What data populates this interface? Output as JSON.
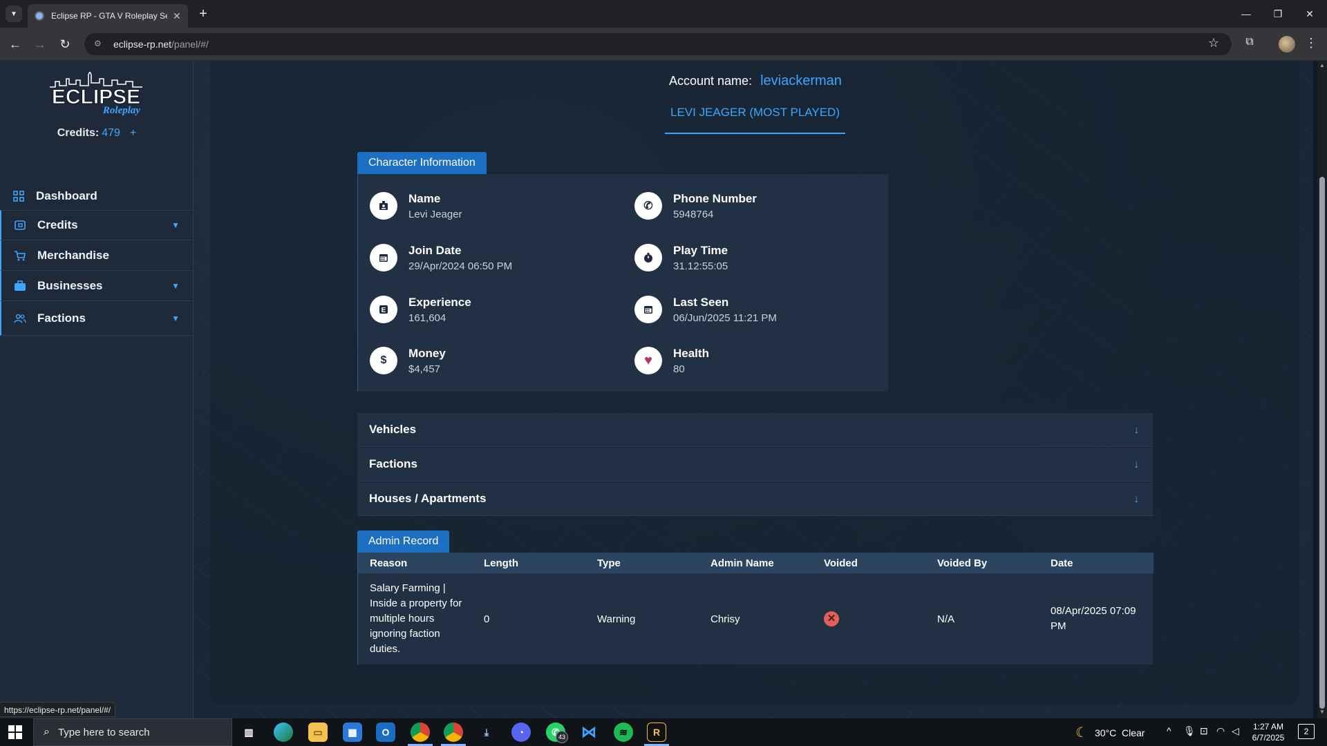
{
  "browser": {
    "tab_title": "Eclipse RP - GTA V Roleplay Server",
    "url_host": "eclipse-rp.net",
    "url_path": "/panel/#/",
    "status_url": "https://eclipse-rp.net/panel/#/"
  },
  "sidebar": {
    "logo_main": "ECLIPSE",
    "logo_sub": "Roleplay",
    "credits_label": "Credits:",
    "credits_value": "479",
    "credits_add": "+",
    "items": [
      {
        "label": "Dashboard",
        "icon": "dashboard-icon",
        "has_chevron": false
      },
      {
        "label": "Credits",
        "icon": "credits-icon",
        "has_chevron": true
      },
      {
        "label": "Merchandise",
        "icon": "cart-icon",
        "has_chevron": false
      },
      {
        "label": "Businesses",
        "icon": "briefcase-icon",
        "has_chevron": true
      },
      {
        "label": "Factions",
        "icon": "people-icon",
        "has_chevron": true
      }
    ]
  },
  "account": {
    "label": "Account name:",
    "name": "leviackerman",
    "character_tab": "LEVI JEAGER (MOST PLAYED)"
  },
  "character_info": {
    "heading": "Character Information",
    "items": [
      {
        "title": "Name",
        "value": "Levi Jeager",
        "icon": "id-badge-icon"
      },
      {
        "title": "Phone Number",
        "value": "5948764",
        "icon": "phone-icon"
      },
      {
        "title": "Join Date",
        "value": "29/Apr/2024 06:50 PM",
        "icon": "calendar-icon"
      },
      {
        "title": "Play Time",
        "value": "31.12:55:05",
        "icon": "stopwatch-icon"
      },
      {
        "title": "Experience",
        "value": "161,604",
        "icon": "experience-icon"
      },
      {
        "title": "Last Seen",
        "value": "06/Jun/2025 11:21 PM",
        "icon": "calendar-icon"
      },
      {
        "title": "Money",
        "value": "$4,457",
        "icon": "dollar-icon"
      },
      {
        "title": "Health",
        "value": "80",
        "icon": "heart-icon"
      }
    ]
  },
  "accordions": [
    "Vehicles",
    "Factions",
    "Houses / Apartments"
  ],
  "admin_record": {
    "heading": "Admin Record",
    "columns": [
      "Reason",
      "Length",
      "Type",
      "Admin Name",
      "Voided",
      "Voided By",
      "Date"
    ],
    "rows": [
      {
        "reason": "Salary Farming | Inside a property for multiple hours ignoring faction duties.",
        "length": "0",
        "type": "Warning",
        "admin_name": "Chrisy",
        "voided": "x-circle-icon",
        "voided_by": "N/A",
        "date": "08/Apr/2025 07:09 PM"
      }
    ]
  },
  "taskbar": {
    "search_placeholder": "Type here to search",
    "whatsapp_badge": "43",
    "weather_temp": "30°C",
    "weather_text": "Clear",
    "time": "1:27 AM",
    "date": "6/7/2025",
    "notifications": "2"
  },
  "colors": {
    "accent": "#3ea6ff",
    "label_blue": "#1d6fc2",
    "panel": "#223043",
    "sidebar": "#1e2a3a",
    "health_heart": "#b03a64"
  }
}
